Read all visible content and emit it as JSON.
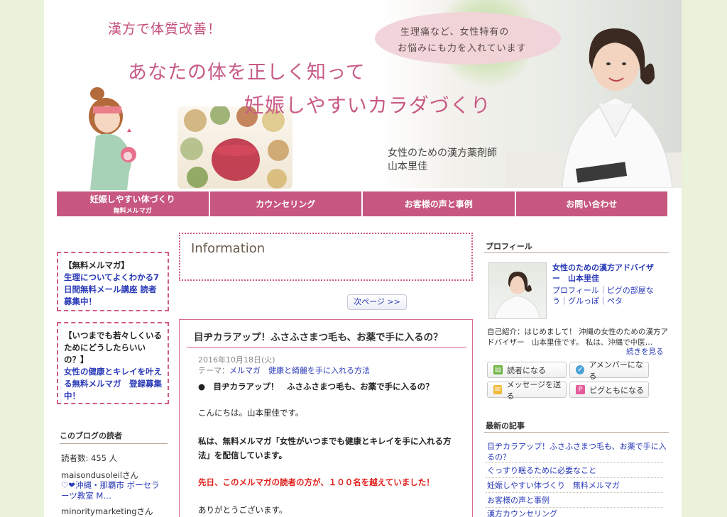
{
  "header": {
    "tagline": "漢方で体質改善！",
    "headline1": "あなたの体を正しく知って",
    "headline2": "妊娠しやすいカラダづくり",
    "bubble_line1": "生理痛など、女性特有の",
    "bubble_line2": "お悩みにも力を入れています",
    "role": "女性のための漢方薬剤師",
    "name": "山本里佳"
  },
  "nav": [
    {
      "label": "妊娠しやすい体づくり",
      "sub": "無料メルマガ"
    },
    {
      "label": "カウンセリング",
      "sub": ""
    },
    {
      "label": "お客様の声と事例",
      "sub": ""
    },
    {
      "label": "お問い合わせ",
      "sub": ""
    }
  ],
  "left": {
    "box1": {
      "heading": "【無料メルマガ】",
      "link": "生理についてよくわかる7日間無料メール講座 読者募集中！"
    },
    "box2": {
      "heading": "【いつまでも若々しくいるためにどうしたらいいの？】",
      "link": "女性の健康とキレイを叶える無料メルマガ　登録募集中！"
    },
    "readers_title": "このブログの読者",
    "readers_count": "読者数: 455 人",
    "readers": [
      {
        "name": "maisondusoleilさん",
        "desc": "♡❤沖縄・那覇市 ボーセラーツ教室 M…"
      },
      {
        "name": "minoritymarketingさん",
        "desc": ""
      }
    ]
  },
  "center": {
    "info_title": "Information",
    "next_page": "次ページ >>",
    "article": {
      "title": "目ヂカラアップ！ふさふさまつ毛も、お薬で手に入るの？",
      "date": "2016年10月18日(火)",
      "theme_prefix": "テーマ：",
      "theme": "メルマガ　健康と綺麗を手に入れる方法",
      "bullet": "●　目ヂカラアップ！　ふさふさまつ毛も、お薬で手に入るの？",
      "greeting": "こんにちは。山本里佳です。",
      "para1": "私は、無料メルマガ「女性がいつまでも健康とキレイを手に入れる方法」を配信しています。",
      "para2": "先日、このメルマガの読者の方が、１００名を越えていました！",
      "thanks": "ありがとうございます。"
    }
  },
  "right": {
    "profile_title": "プロフィール",
    "profile_name": "女性のための漢方アドバイザー　山本里佳",
    "profile_links": "プロフィール｜ピグの部屋なう｜グルっぽ｜ペタ",
    "intro": "自己紹介：はじめまして！ 沖縄の女性のための漢方アドバイザー　山本里佳です。 私は、沖縄で中医…",
    "more": "続きを見る",
    "buttons": {
      "reader": "読者になる",
      "amember": "アメンバーになる",
      "message": "メッセージを送る",
      "pigg": "ピグともになる"
    },
    "recent_title": "最新の記事",
    "recent": [
      "目ヂカラアップ！ふさふさまつ毛も、お薬で手に入るの？",
      "ぐっすり眠るために必要なこと",
      "妊娠しやすい体づくり　無料メルマガ",
      "お客様の声と事例",
      "漢方カウンセリング"
    ]
  },
  "colors": {
    "accent_pink": "#c7577f",
    "link_blue": "#2a3ab8",
    "alert_red": "#e0201c",
    "page_bg": "#eaf3d9"
  }
}
